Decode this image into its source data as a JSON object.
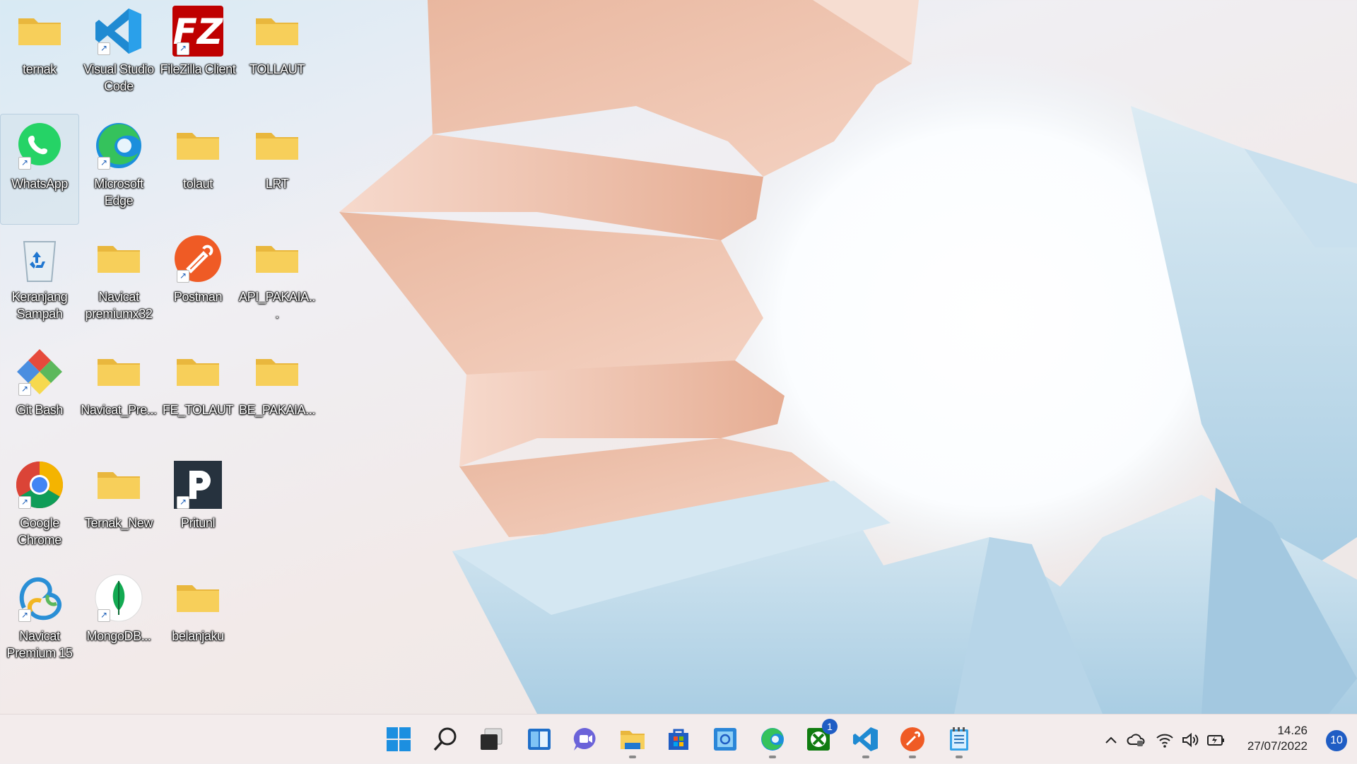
{
  "desktop": {
    "icons": [
      {
        "label": "ternak"
      },
      {
        "label": "Visual Studio Code"
      },
      {
        "label": "FileZilla Client"
      },
      {
        "label": "TOLLAUT"
      },
      {
        "label": "WhatsApp"
      },
      {
        "label": "Microsoft Edge"
      },
      {
        "label": "tolaut"
      },
      {
        "label": "LRT"
      },
      {
        "label": "Keranjang Sampah"
      },
      {
        "label": "Navicat premiumx32"
      },
      {
        "label": "Postman"
      },
      {
        "label": "API_PAKAIA..."
      },
      {
        "label": "Git Bash"
      },
      {
        "label": "Navicat_Pre..."
      },
      {
        "label": "FE_TOLAUT"
      },
      {
        "label": "BE_PAKAIA..."
      },
      {
        "label": "Google Chrome"
      },
      {
        "label": "Ternak_New"
      },
      {
        "label": "Pritunl"
      },
      {
        "label": "Navicat Premium 15"
      },
      {
        "label": "MongoDB..."
      },
      {
        "label": "belanjaku"
      }
    ]
  },
  "taskbar": {
    "badge_xbox": "1",
    "clock_time": "14.26",
    "clock_date": "27/07/2022",
    "notification_count": "10"
  },
  "colors": {
    "accent": "#1f5dc4",
    "folder": "#f7cf5a",
    "taskbar_bg": "#f3ecec"
  }
}
